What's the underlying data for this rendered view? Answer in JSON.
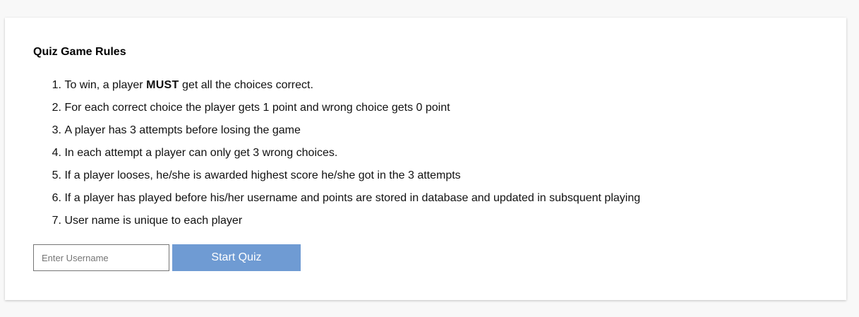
{
  "card": {
    "title": "Quiz Game Rules",
    "rules": [
      {
        "num": "1.",
        "pre": "To win, a player ",
        "bold": "MUST",
        "post": " get all the choices correct."
      },
      {
        "num": "2.",
        "text": "For each correct choice the player gets 1 point and wrong choice gets 0 point"
      },
      {
        "num": "3.",
        "text": "A player has 3 attempts before losing the game"
      },
      {
        "num": "4.",
        "text": "In each attempt a player can only get 3 wrong choices."
      },
      {
        "num": "5.",
        "text": "If a player looses, he/she is awarded highest score he/she got in the 3 attempts"
      },
      {
        "num": "6.",
        "text": "If a player has played before his/her username and points are stored in database and updated in subsquent playing"
      },
      {
        "num": "7.",
        "text": "User name is unique to each player"
      }
    ],
    "username": {
      "value": "",
      "placeholder": "Enter Username"
    },
    "start_button_label": "Start Quiz"
  },
  "colors": {
    "page_background": "#f8f8f8",
    "card_background": "#ffffff",
    "button_background": "#6f9bd3",
    "button_text": "#ffffff"
  }
}
